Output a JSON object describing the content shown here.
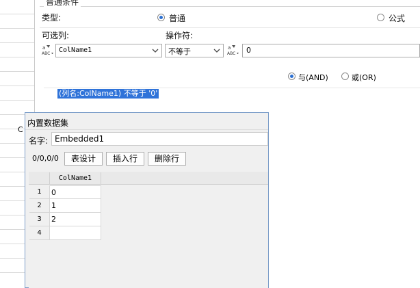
{
  "background_strip": {
    "cell_text": "C"
  },
  "condition_panel": {
    "group_title": "普通条件",
    "type_label": "类型:",
    "type_options": [
      {
        "label": "普通",
        "selected": true
      },
      {
        "label": "公式",
        "selected": false
      }
    ],
    "column_label": "可选列:",
    "operator_label": "操作符:",
    "column_value": "ColName1",
    "operator_value": "不等于",
    "value_field": "0",
    "logic_options": [
      {
        "label": "与(AND)",
        "selected": true
      },
      {
        "label": "或(OR)",
        "selected": false
      }
    ],
    "condition_preview": "(列名:ColName1) 不等于 '0'"
  },
  "dataset_dialog": {
    "title": "内置数据集",
    "name_label": "名字:",
    "name_value": "Embedded1",
    "counter": "0/0,0/0",
    "buttons": {
      "design": "表设计",
      "insert_row": "插入行",
      "delete_row": "删除行"
    },
    "table": {
      "columns": [
        "ColName1"
      ],
      "rows": [
        {
          "num": "1",
          "value": "0"
        },
        {
          "num": "2",
          "value": "1"
        },
        {
          "num": "3",
          "value": "2"
        },
        {
          "num": "4",
          "value": ""
        }
      ]
    }
  },
  "colors": {
    "accent": "#2b6fd1",
    "selection": "#2f73d9",
    "dialog_border": "#7a9cc8"
  }
}
